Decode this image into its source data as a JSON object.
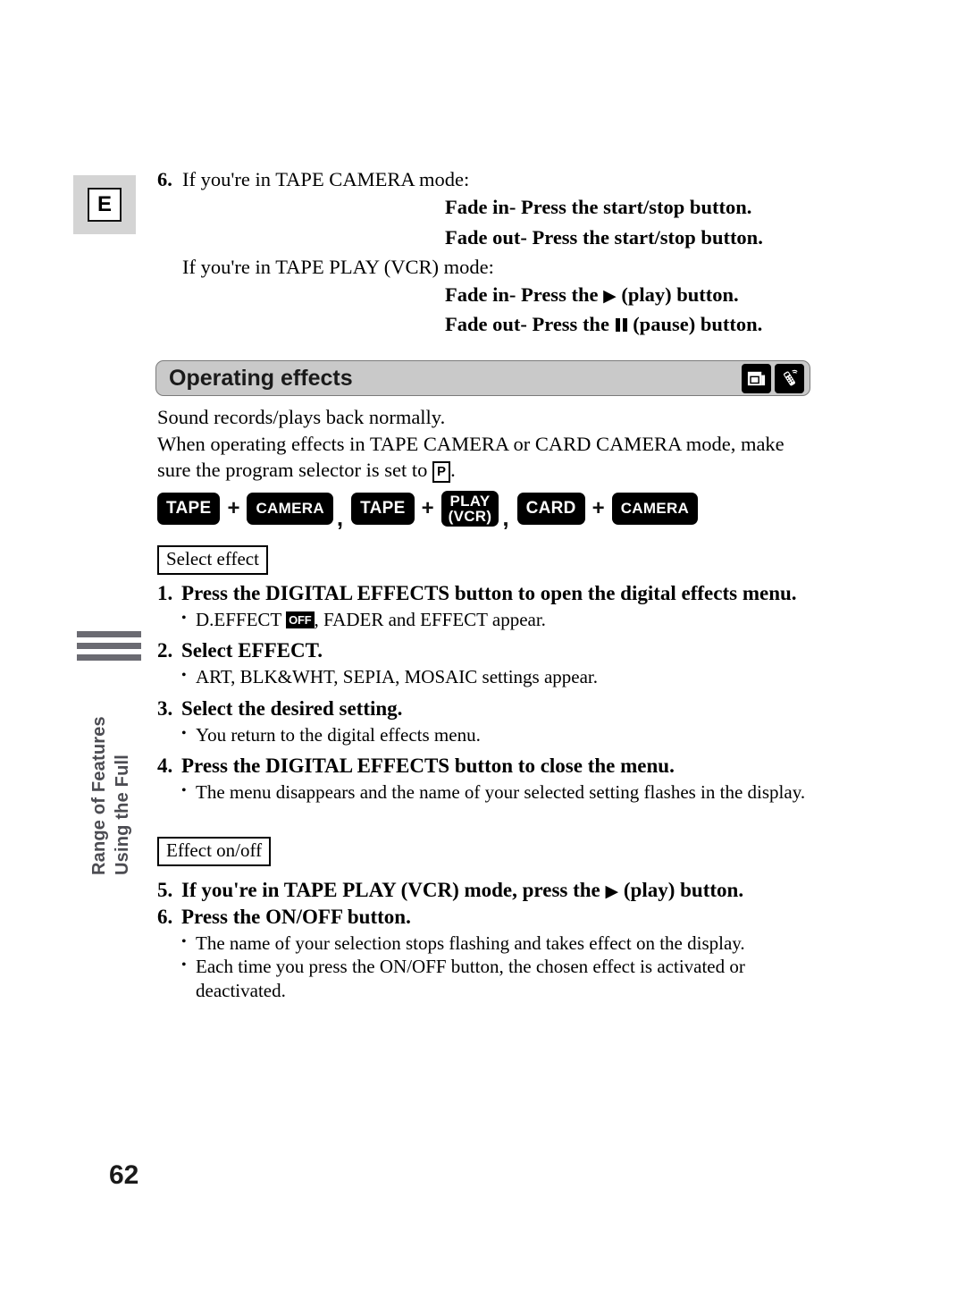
{
  "page": {
    "number": "62",
    "language_badge": "E"
  },
  "side_tab": {
    "line1": "Using the Full",
    "line2": "Range of Features"
  },
  "step6_top": {
    "number": "6.",
    "text": "If you're in TAPE CAMERA mode:",
    "fade_in": "Fade in- Press the start/stop button.",
    "fade_out": "Fade out- Press the start/stop button.",
    "vcr_intro": "If you're in TAPE PLAY (VCR) mode:",
    "vcr_fade_in_pre": "Fade in- Press the ",
    "vcr_fade_in_post": " (play) button.",
    "vcr_fade_out_pre": "Fade out- Press the ",
    "vcr_fade_out_post": " (pause) button."
  },
  "section": {
    "title": "Operating effects",
    "icons": [
      "card-icon",
      "remote-control-icon"
    ]
  },
  "intro": {
    "line1": "Sound records/plays back normally.",
    "line2": "When operating effects in TAPE CAMERA or CARD CAMERA mode, make",
    "line3_pre": "sure the program selector is set to ",
    "program_symbol": "P",
    "line3_post": "."
  },
  "mode_row": {
    "groups": [
      {
        "left": "TAPE",
        "plus": "+",
        "right": "CAMERA",
        "right_two_line": false,
        "separator": ","
      },
      {
        "left": "TAPE",
        "plus": "+",
        "right_line1": "PLAY",
        "right_line2": "(VCR)",
        "right_two_line": true,
        "separator": ","
      },
      {
        "left": "CARD",
        "plus": "+",
        "right": "CAMERA",
        "right_two_line": false,
        "separator": ""
      }
    ]
  },
  "tags": {
    "select_effect": "Select effect",
    "effect_onoff": "Effect on/off"
  },
  "steps_a": [
    {
      "number": "1.",
      "title": "Press the DIGITAL EFFECTS button to open the digital effects menu.",
      "bullets": [
        {
          "pre": "D.EFFECT ",
          "chip": "OFF",
          "post": ", FADER and EFFECT appear."
        }
      ]
    },
    {
      "number": "2.",
      "title": "Select EFFECT.",
      "bullets": [
        {
          "pre": "ART, BLK&WHT, SEPIA, MOSAIC settings appear.",
          "chip": "",
          "post": ""
        }
      ]
    },
    {
      "number": "3.",
      "title": "Select the desired setting.",
      "bullets": [
        {
          "pre": "You return to the digital effects menu.",
          "chip": "",
          "post": ""
        }
      ]
    },
    {
      "number": "4.",
      "title": "Press the DIGITAL EFFECTS button to close the menu.",
      "bullets": [
        {
          "pre": "The menu disappears and the name of your selected setting flashes in the display.",
          "chip": "",
          "post": ""
        }
      ]
    }
  ],
  "steps_b": [
    {
      "number": "5.",
      "title_pre": "If you're in TAPE PLAY (VCR) mode, press the ",
      "title_post": " (play) button.",
      "bullets": []
    },
    {
      "number": "6.",
      "title": "Press the ON/OFF button.",
      "bullets": [
        {
          "pre": "The name of your selection stops flashing and takes effect on the display.",
          "chip": "",
          "post": ""
        },
        {
          "pre": "Each time you press the ON/OFF button, the chosen effect is activated or deactivated.",
          "chip": "",
          "post": ""
        }
      ]
    }
  ]
}
